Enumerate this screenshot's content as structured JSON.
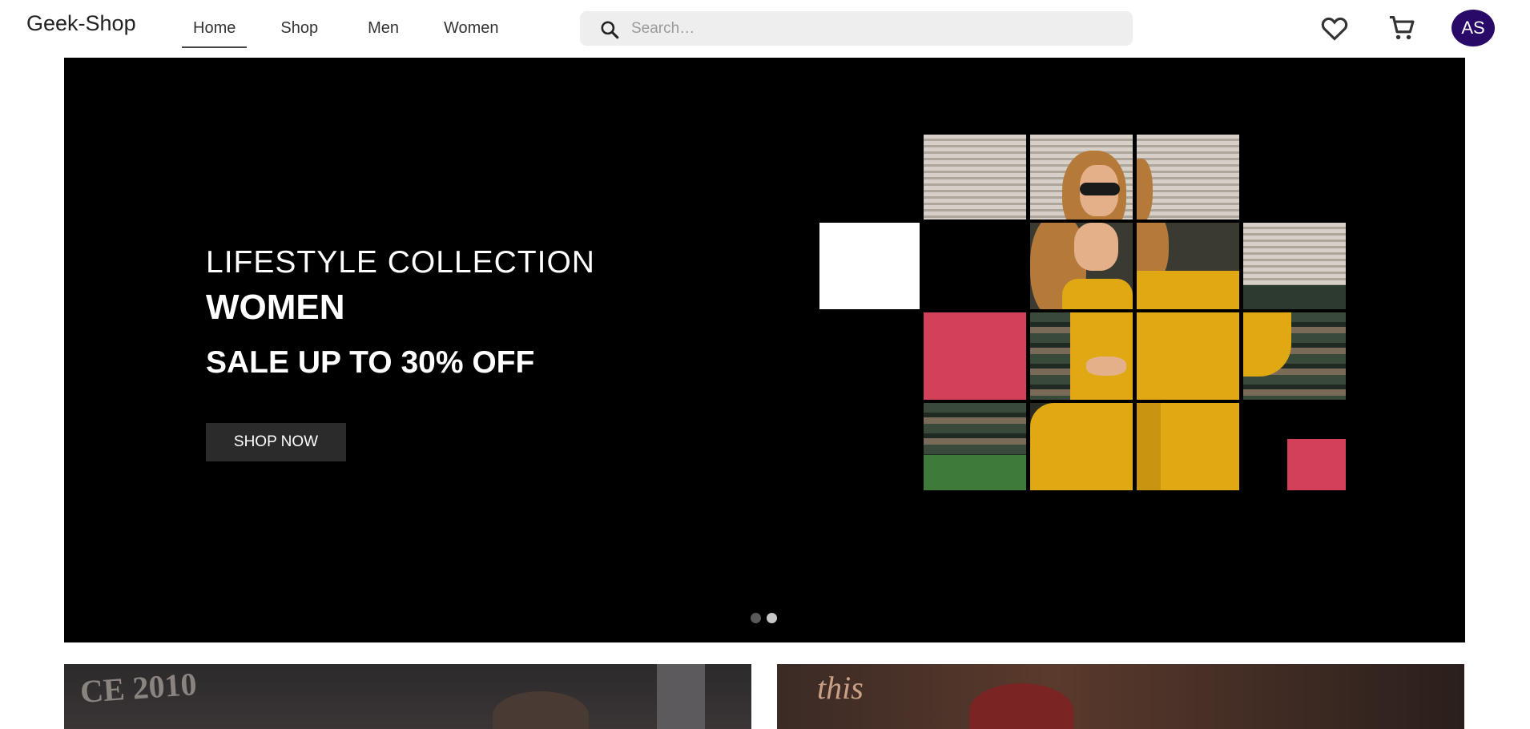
{
  "app": {
    "logo": "Geek-Shop"
  },
  "nav": {
    "items": [
      {
        "label": "Home",
        "active": true
      },
      {
        "label": "Shop",
        "active": false
      },
      {
        "label": "Men",
        "active": false
      },
      {
        "label": "Women",
        "active": false
      }
    ]
  },
  "search": {
    "placeholder": "Search…",
    "value": "",
    "icon": "search-icon"
  },
  "header_icons": {
    "wishlist": "heart-icon",
    "cart": "cart-icon"
  },
  "user": {
    "initials": "AS",
    "avatar_color": "#2a0a68"
  },
  "hero": {
    "line1": "LIFESTYLE COLLECTION",
    "line2": "WOMEN",
    "line3": "SALE UP TO 30% OFF",
    "cta": "SHOP NOW",
    "accent_color": "#d3405a",
    "slides": 2,
    "active_slide": 2
  },
  "cards": [
    {
      "sign_text": "CE 2010"
    },
    {
      "neon_text": "this"
    }
  ]
}
